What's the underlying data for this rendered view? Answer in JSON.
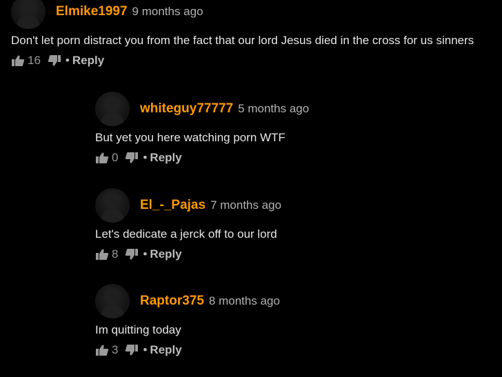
{
  "comments": [
    {
      "username": "Elmike1997",
      "time": "9 months ago",
      "text": "Don't let porn distract you from the fact that our lord Jesus died in the cross for us sinners",
      "likes": "16",
      "reply_label": "Reply"
    },
    {
      "username": "whiteguy77777",
      "time": "5 months ago",
      "text": "But yet you here watching porn WTF",
      "likes": "0",
      "reply_label": "Reply"
    },
    {
      "username": "El_-_Pajas",
      "time": "7 months ago",
      "text": "Let's dedicate a jerck off to our lord",
      "likes": "8",
      "reply_label": "Reply"
    },
    {
      "username": "Raptor375",
      "time": "8 months ago",
      "text": "Im quitting today",
      "likes": "3",
      "reply_label": "Reply"
    }
  ],
  "ui": {
    "separator": "•",
    "colors": {
      "background": "#000000",
      "username": "#ff9900",
      "text": "#e8e8e8",
      "muted": "#9a9a9a"
    },
    "icons": [
      "avatar-placeholder",
      "thumbs-up-icon",
      "thumbs-down-icon"
    ]
  }
}
